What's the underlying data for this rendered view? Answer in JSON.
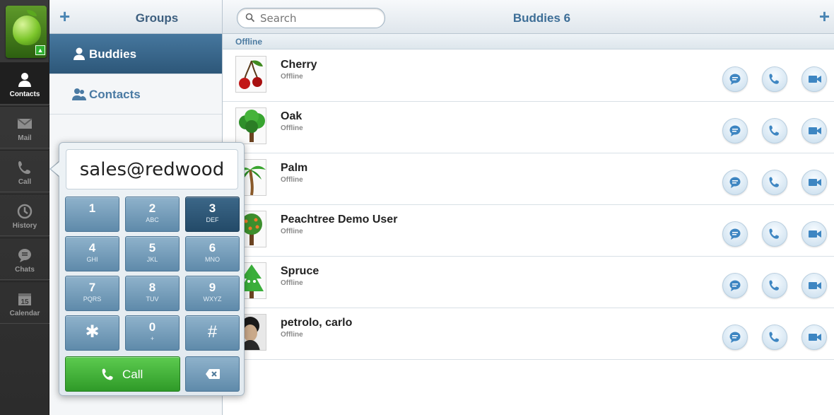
{
  "rail": {
    "items": [
      {
        "label": "Contacts",
        "icon": "person-icon",
        "active": true
      },
      {
        "label": "Mail",
        "icon": "mail-icon"
      },
      {
        "label": "Call",
        "icon": "phone-icon"
      },
      {
        "label": "History",
        "icon": "clock-icon"
      },
      {
        "label": "Chats",
        "icon": "chat-bubble-icon"
      },
      {
        "label": "Calendar",
        "icon": "calendar-icon",
        "badge": "15"
      }
    ]
  },
  "groups": {
    "title": "Groups",
    "add_label": "+",
    "items": [
      {
        "label": "Buddies",
        "active": true
      },
      {
        "label": "Contacts"
      }
    ]
  },
  "main": {
    "search_placeholder": "Search",
    "title": "Buddies 6",
    "add_label": "+",
    "section_label": "Offline",
    "buddies": [
      {
        "name": "Cherry",
        "status": "Offline",
        "avatar": "cherry"
      },
      {
        "name": "Oak",
        "status": "Offline",
        "avatar": "oak-tree"
      },
      {
        "name": "Palm",
        "status": "Offline",
        "avatar": "palm-tree"
      },
      {
        "name": "Peachtree Demo User",
        "status": "Offline",
        "avatar": "peach-tree"
      },
      {
        "name": "Spruce",
        "status": "Offline",
        "avatar": "spruce-tree"
      },
      {
        "name": "petrolo, carlo",
        "status": "Offline",
        "avatar": "photo"
      }
    ]
  },
  "dialer": {
    "value": "sales@redwood",
    "keys": [
      {
        "num": "1",
        "sub": ""
      },
      {
        "num": "2",
        "sub": "ABC"
      },
      {
        "num": "3",
        "sub": "DEF"
      },
      {
        "num": "4",
        "sub": "GHI"
      },
      {
        "num": "5",
        "sub": "JKL"
      },
      {
        "num": "6",
        "sub": "MNO"
      },
      {
        "num": "7",
        "sub": "PQRS"
      },
      {
        "num": "8",
        "sub": "TUV"
      },
      {
        "num": "9",
        "sub": "WXYZ"
      },
      {
        "num": "✱",
        "sub": ""
      },
      {
        "num": "0",
        "sub": "+"
      },
      {
        "num": "#",
        "sub": ""
      }
    ],
    "call_label": "Call"
  },
  "colors": {
    "accent": "#3d6e97",
    "call_green": "#3fae37",
    "rail_dark": "#2c2c2c"
  }
}
